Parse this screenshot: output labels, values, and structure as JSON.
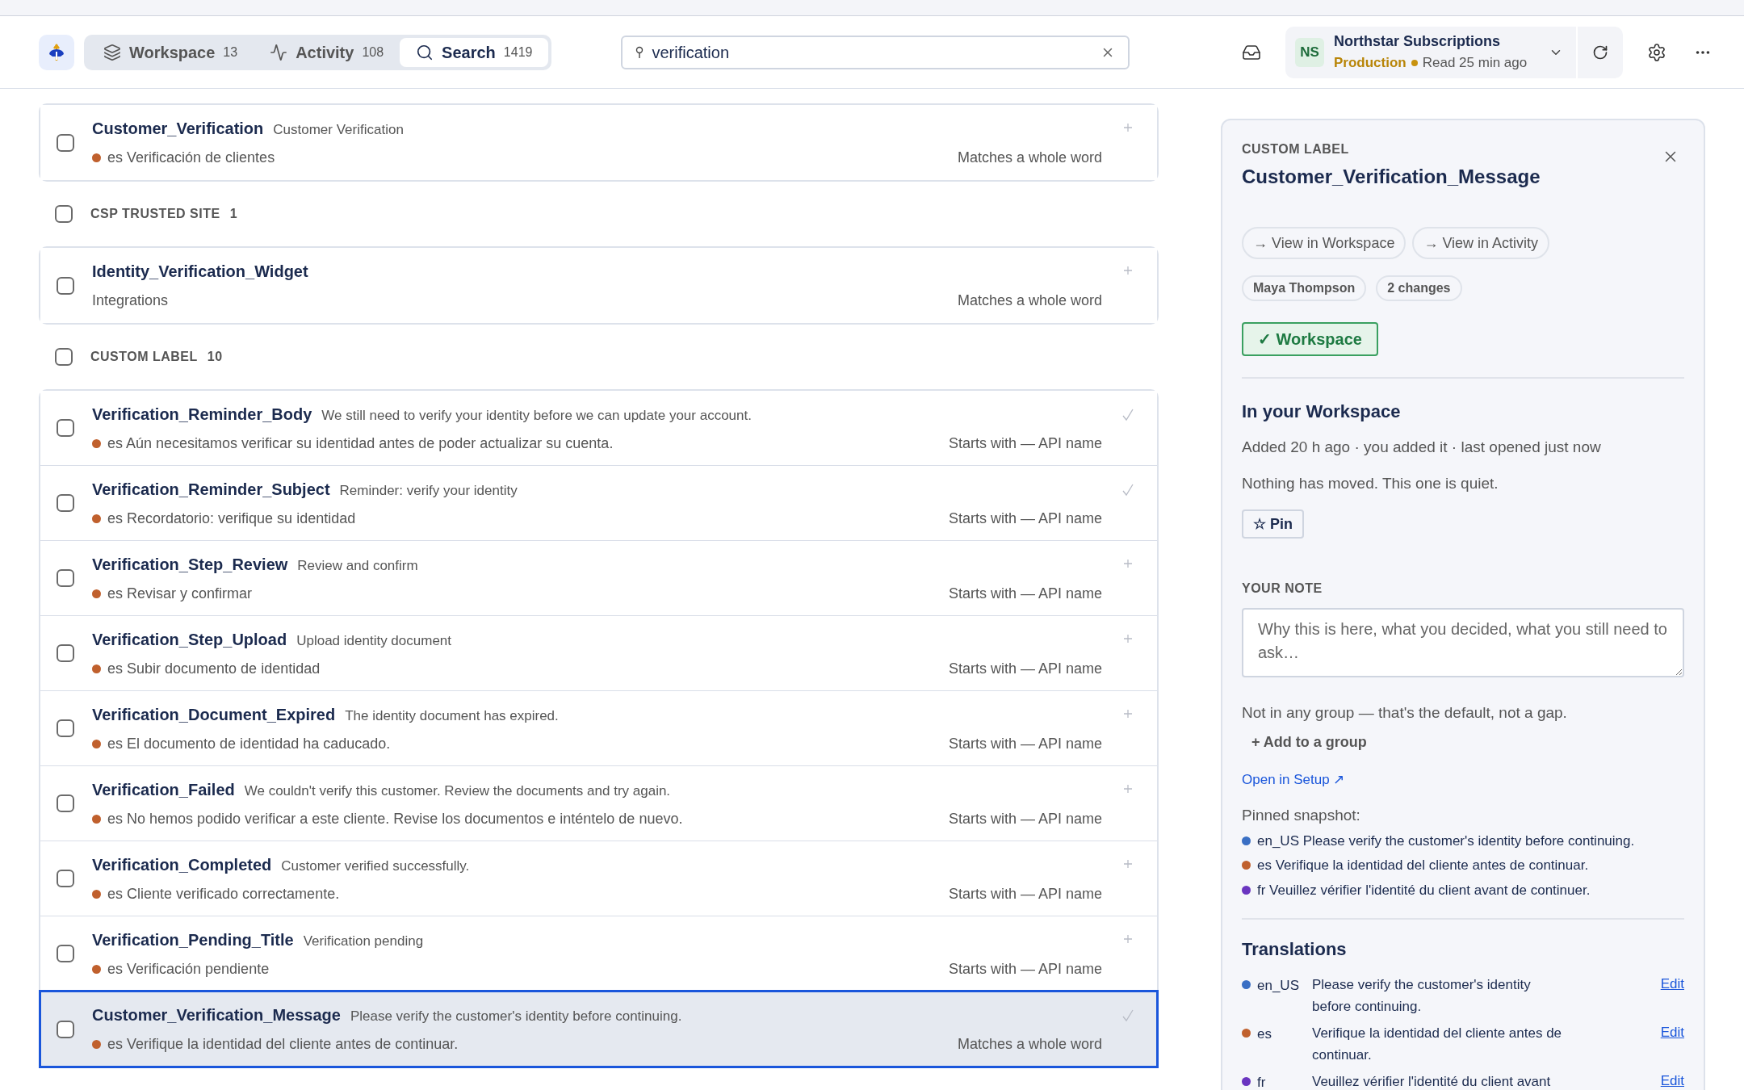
{
  "nav": {
    "tabs": [
      {
        "label": "Workspace",
        "count": "13",
        "selected": false
      },
      {
        "label": "Activity",
        "count": "108",
        "selected": false
      },
      {
        "label": "Search",
        "count": "1419",
        "selected": true
      }
    ],
    "search": {
      "value": "verification"
    },
    "org": {
      "initials": "NS",
      "name": "Northstar Subscriptions",
      "environment": "Production",
      "read": "Read 25 min ago"
    }
  },
  "sections": [
    {
      "items": [
        {
          "kind": "translated",
          "name": "Customer_Verification",
          "description": "Customer Verification",
          "locale": "es",
          "color": "#c0602d",
          "text": "Verificación de clientes",
          "match": "Matches a whole word",
          "added": false,
          "checked": false,
          "selected": false
        }
      ]
    },
    {
      "header": {
        "label": "CSP TRUSTED SITE",
        "count": "1",
        "checked": false
      },
      "items": [
        {
          "kind": "plain",
          "name": "Identity_Verification_Widget",
          "text": "Integrations",
          "match": "Matches a whole word",
          "added": false,
          "checked": false,
          "selected": false
        }
      ]
    },
    {
      "header": {
        "label": "CUSTOM LABEL",
        "count": "10",
        "checked": false
      },
      "items": [
        {
          "kind": "translated",
          "name": "Verification_Reminder_Body",
          "description": "We still need to verify your identity before we can update your account.",
          "locale": "es",
          "color": "#c0602d",
          "text": "Aún necesitamos verificar su identidad antes de poder actualizar su cuenta.",
          "match": "Starts with — API name",
          "added": true,
          "checked": false,
          "selected": false
        },
        {
          "kind": "translated",
          "name": "Verification_Reminder_Subject",
          "description": "Reminder: verify your identity",
          "locale": "es",
          "color": "#c0602d",
          "text": "Recordatorio: verifique su identidad",
          "match": "Starts with — API name",
          "added": true,
          "checked": false,
          "selected": false
        },
        {
          "kind": "translated",
          "name": "Verification_Step_Review",
          "description": "Review and confirm",
          "locale": "es",
          "color": "#c0602d",
          "text": "Revisar y confirmar",
          "match": "Starts with — API name",
          "added": false,
          "checked": false,
          "selected": false
        },
        {
          "kind": "translated",
          "name": "Verification_Step_Upload",
          "description": "Upload identity document",
          "locale": "es",
          "color": "#c0602d",
          "text": "Subir documento de identidad",
          "match": "Starts with — API name",
          "added": false,
          "checked": false,
          "selected": false
        },
        {
          "kind": "translated",
          "name": "Verification_Document_Expired",
          "description": "The identity document has expired.",
          "locale": "es",
          "color": "#c0602d",
          "text": "El documento de identidad ha caducado.",
          "match": "Starts with — API name",
          "added": false,
          "checked": false,
          "selected": false
        },
        {
          "kind": "translated",
          "name": "Verification_Failed",
          "description": "We couldn't verify this customer. Review the documents and try again.",
          "locale": "es",
          "color": "#c0602d",
          "text": "No hemos podido verificar a este cliente. Revise los documentos e inténtelo de nuevo.",
          "match": "Starts with — API name",
          "added": false,
          "checked": false,
          "selected": false
        },
        {
          "kind": "translated",
          "name": "Verification_Completed",
          "description": "Customer verified successfully.",
          "locale": "es",
          "color": "#c0602d",
          "text": "Cliente verificado correctamente.",
          "match": "Starts with — API name",
          "added": false,
          "checked": false,
          "selected": false
        },
        {
          "kind": "translated",
          "name": "Verification_Pending_Title",
          "description": "Verification pending",
          "locale": "es",
          "color": "#c0602d",
          "text": "Verificación pendiente",
          "match": "Starts with — API name",
          "added": false,
          "checked": false,
          "selected": false
        },
        {
          "kind": "translated",
          "name": "Customer_Verification_Message",
          "description": "Please verify the customer's identity before continuing.",
          "locale": "es",
          "color": "#c0602d",
          "text": "Verifique la identidad del cliente antes de continuar.",
          "match": "Matches a whole word",
          "added": true,
          "checked": false,
          "selected": true
        }
      ]
    }
  ],
  "detail": {
    "kicker": "CUSTOM LABEL",
    "title": "Customer_Verification_Message",
    "links": [
      "→ View in Workspace",
      "→ View in Activity"
    ],
    "tags": [
      "Maya Thompson",
      "2 changes"
    ],
    "workspace_button": {
      "label": "✓ Workspace",
      "on": true
    },
    "workspace": {
      "heading": "In your Workspace",
      "meta": "Added 20 h ago · you added it · last opened just now",
      "status": "Nothing has moved. This one is quiet.",
      "pin": "☆ Pin"
    },
    "note": {
      "label": "YOUR NOTE",
      "placeholder": "Why this is here, what you decided, what you still need to ask…"
    },
    "group": {
      "text": "Not in any group — that's the default, not a gap.",
      "action": "+ Add to a group"
    },
    "setup_link": "Open in Setup ↗",
    "snapshot": {
      "label": "Pinned snapshot:",
      "lines": [
        {
          "text": "en_US Please verify the customer's identity before continuing.",
          "color": "#3a6fc4"
        },
        {
          "text": "es Verifique la identidad del cliente antes de continuar.",
          "color": "#c0602d"
        },
        {
          "text": "fr Veuillez vérifier l'identité du client avant de continuer.",
          "color": "#6a35c0"
        }
      ]
    },
    "translations": {
      "heading": "Translations",
      "rows": [
        {
          "locale": "en_US",
          "text": "Please verify the customer's identity before continuing.",
          "color": "#3a6fc4",
          "action": "Edit"
        },
        {
          "locale": "es",
          "text": "Verifique la identidad del cliente antes de continuar.",
          "color": "#c0602d",
          "action": "Edit"
        },
        {
          "locale": "fr",
          "text": "Veuillez vérifier l'identité du client avant",
          "color": "#6a35c0",
          "action": "Edit"
        }
      ]
    }
  }
}
